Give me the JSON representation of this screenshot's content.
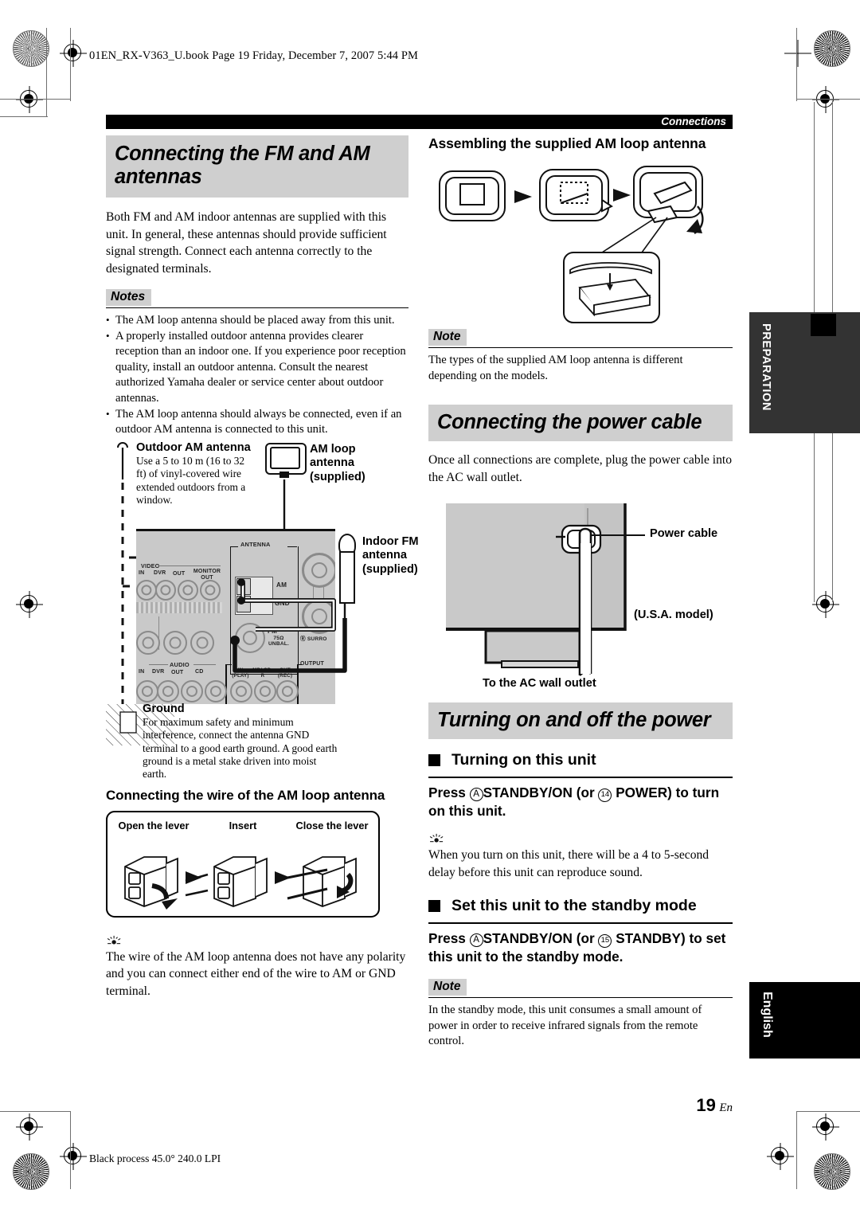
{
  "print_header": "01EN_RX-V363_U.book  Page 19  Friday, December 7, 2007  5:44 PM",
  "running_head": "Connections",
  "left_column": {
    "heading": "Connecting the FM and AM antennas",
    "intro": "Both FM and AM indoor antennas are supplied with this unit. In general, these antennas should provide sufficient signal strength. Connect each antenna correctly to the designated terminals.",
    "notes_label": "Notes",
    "notes": [
      "The AM loop antenna should be placed away from this unit.",
      "A properly installed outdoor antenna provides clearer reception than an indoor one. If you experience poor reception quality, install an outdoor antenna. Consult the nearest authorized Yamaha dealer or service center about outdoor antennas.",
      "The AM loop antenna should always be connected, even if an outdoor AM antenna is connected to this unit."
    ],
    "figure_antenna": {
      "outdoor_title": "Outdoor AM antenna",
      "outdoor_text": "Use a 5 to 10 m (16 to 32 ft) of vinyl-covered wire extended outdoors from a window.",
      "amloop_title": "AM loop antenna (supplied)",
      "indoorfm_title": "Indoor FM antenna (supplied)",
      "ground_title": "Ground",
      "ground_text": "For maximum safety and minimum interference, connect the antenna GND terminal to a good earth ground. A good earth ground is a metal stake driven into moist earth.",
      "panel_labels": {
        "antenna": "ANTENNA",
        "am": "AM",
        "gnd": "GND",
        "fm": "FM",
        "fm_sub": "75Ω UNBAL.",
        "video": "VIDEO",
        "video_in": "IN",
        "video_dvr": "DVR",
        "video_out": "OUT",
        "monitor_out": "MONITOR OUT",
        "surround": "SURROUND",
        "audio": "AUDIO",
        "audio_in": "IN",
        "audio_dvr": "DVR",
        "audio_out": "OUT",
        "audio_cd": "CD",
        "md_in": "IN (PLAY)",
        "md_cdr": "MD/ CD-R",
        "md_out": "OUT (REC)",
        "output": "OUTPUT"
      }
    },
    "wire_section_title": "Connecting the wire of the AM loop antenna",
    "wire_steps": [
      "Open the lever",
      "Insert",
      "Close the lever"
    ],
    "wire_tip": "The wire of the AM loop antenna does not have any polarity and you can connect either end of the wire to AM or GND terminal."
  },
  "right_column": {
    "assembling_title": "Assembling the supplied AM loop antenna",
    "note1_label": "Note",
    "note1_text": "The types of the supplied AM loop antenna is different depending on the models.",
    "power_heading": "Connecting the power cable",
    "power_text": "Once all connections are complete, plug the power cable into the AC wall outlet.",
    "power_figure": {
      "power_cable": "Power cable",
      "usa_model": "(U.S.A. model)",
      "to_outlet": "To the AC wall outlet"
    },
    "turning_heading": "Turning on and off the power",
    "turn_on_sub": "Turning on this unit",
    "turn_on_instruction": {
      "pre": "Press ",
      "badge_a": "A",
      "b1": "STANDBY/ON",
      "mid": " (or ",
      "badge_14": "14",
      "b2": "POWER",
      "post": ") to turn on this unit."
    },
    "turn_on_tip": "When you turn on this unit, there will be a 4 to 5-second delay before this unit can reproduce sound.",
    "standby_sub": "Set this unit to the standby mode",
    "standby_instruction": {
      "pre": "Press ",
      "badge_a": "A",
      "b1": "STANDBY/ON",
      "mid": " (or ",
      "badge_15": "15",
      "b2": "STANDBY",
      "post": ") to set this unit to the standby mode."
    },
    "note2_label": "Note",
    "note2_text": "In the standby mode, this unit consumes a small amount of power in order to receive infrared signals from the remote control."
  },
  "tabs": {
    "preparation": "PREPARATION",
    "english": "English"
  },
  "footer": {
    "page_number": "19",
    "page_lang": "En",
    "print_process": "Black process 45.0° 240.0 LPI"
  }
}
